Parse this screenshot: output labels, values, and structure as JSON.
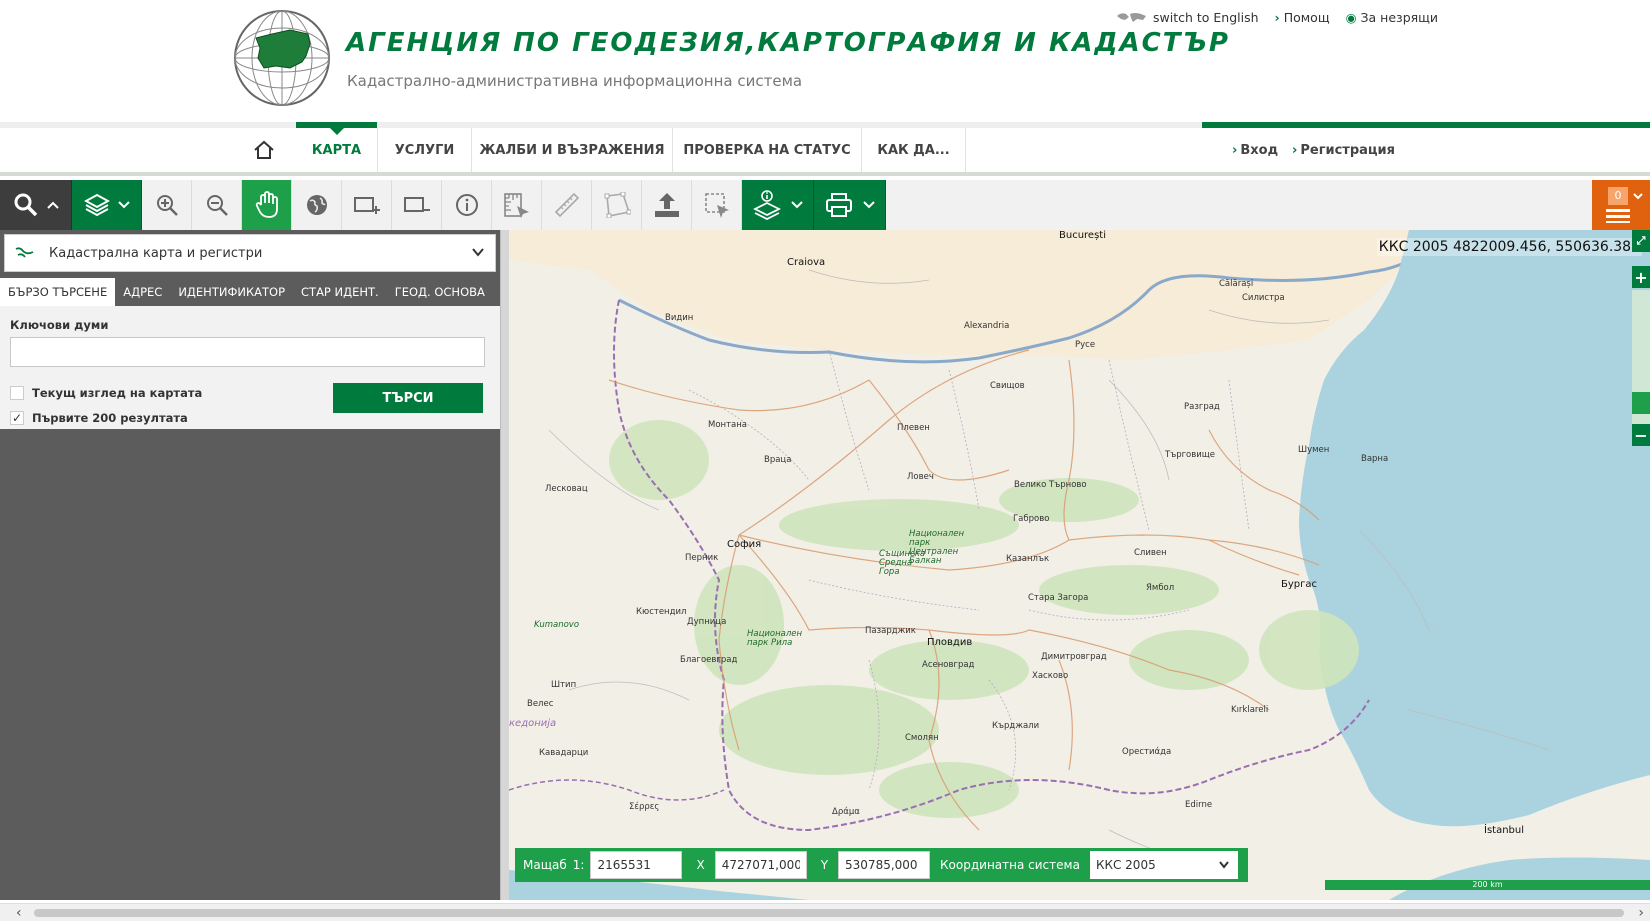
{
  "header": {
    "title": "АГЕНЦИЯ ПО ГЕОДЕЗИЯ,КАРТОГРАФИЯ И КАДАСТЪР",
    "subtitle": "Кадастрално-административна информационна система",
    "links": {
      "english": "switch to English",
      "help": "Помощ",
      "accessibility": "За незрящи"
    }
  },
  "nav": {
    "items": [
      "КАРТА",
      "УСЛУГИ",
      "ЖАЛБИ И ВЪЗРАЖЕНИЯ",
      "ПРОВЕРКА НА СТАТУС",
      "КАК ДА..."
    ],
    "active": "КАРТА",
    "login": "Вход",
    "register": "Регистрация"
  },
  "toolbar": {
    "cart_count": "0",
    "tools": [
      "search-icon",
      "layers-icon",
      "zoom-in-icon",
      "zoom-out-icon",
      "pan-hand-icon",
      "globe-icon",
      "rect-add-icon",
      "rect-remove-icon",
      "info-icon",
      "measure-area-icon",
      "ruler-icon",
      "polygon-icon",
      "upload-icon",
      "select-icon",
      "layer-info-icon",
      "print-icon",
      "cart-icon"
    ]
  },
  "sidebar": {
    "layer": "Кадастрална карта и регистри",
    "tabs": [
      "БЪРЗО ТЪРСЕНЕ",
      "АДРЕС",
      "ИДЕНТИФИКАТОР",
      "СТАР ИДЕНТ.",
      "ГЕОД. ОСНОВА"
    ],
    "active_tab": "БЪРЗО ТЪРСЕНЕ",
    "keywords_label": "Ключови думи",
    "keywords_value": "",
    "current_view_label": "Текущ изглед на картата",
    "current_view_checked": false,
    "first200_label": "Първите 200 резултата",
    "first200_checked": true,
    "search_button": "ТЪРСИ"
  },
  "map": {
    "coord_readout": "ККС 2005 4822009.456, 550636.380",
    "labels": {
      "bucuresti": "București",
      "craiova": "Craiova",
      "calarasi": "Călărași",
      "silistra": "Силистра",
      "alexandria": "Alexandria",
      "ruse": "Русе",
      "svishtov": "Свищов",
      "razgrad": "Разград",
      "vidin": "Видин",
      "montana": "Монтана",
      "pleven": "Плевен",
      "shumen": "Шумен",
      "targovishte": "Търговище",
      "varna": "Варна",
      "vratsa": "Враца",
      "lovech": "Ловеч",
      "veliko_tarnovo": "Велико Търново",
      "gabrovo": "Габрово",
      "sofia": "София",
      "pernik": "Перник",
      "sliven": "Сливен",
      "kazanlak": "Казанлък",
      "yambol": "Ямбол",
      "burgas": "Бургас",
      "stara_zagora": "Стара Загора",
      "kyustendil": "Кюстендил",
      "dupnitsa": "Дупница",
      "pazardzhik": "Пазарджик",
      "plovdiv": "Пловдив",
      "dimitrovgrad": "Димитровград",
      "blagoevgrad": "Благоевград",
      "asenovgrad": "Асеновград",
      "haskovo": "Хасково",
      "kirklareli": "Kırklareli",
      "smolyan": "Смолян",
      "kardzhali": "Кърджали",
      "kavadartsi": "Кавадарци",
      "orestiada": "Орестиάда",
      "edirne": "Edirne",
      "istanbul": "İstanbul",
      "makedonija": "кедонија",
      "drama": "Δράμα",
      "serres": "Σέρρες",
      "lovech_park": "Национален парк Централен Балкан",
      "rila_park": "Национален парк Рила",
      "sredna_gora": "Същинска Средна Гора",
      "kumanovo": "Kumanovo",
      "veles": "Велес",
      "shtip": "Штип",
      "leskovac": "Лесковац"
    },
    "status": {
      "scale_label": "Мащаб",
      "scale_prefix": "1:",
      "scale_value": "2165531",
      "x_label": "X",
      "x_value": "4727071,000",
      "y_label": "Y",
      "y_value": "530785,000",
      "crs_label": "Координатна система",
      "crs_value": "ККС 2005"
    },
    "scale_bar": "200 km"
  },
  "colors": {
    "brand_green": "#007a3d",
    "bright_green": "#1ea04a",
    "orange": "#e0620f",
    "sea": "#a9cce3",
    "sidebar_gray": "#5c5c5c"
  }
}
